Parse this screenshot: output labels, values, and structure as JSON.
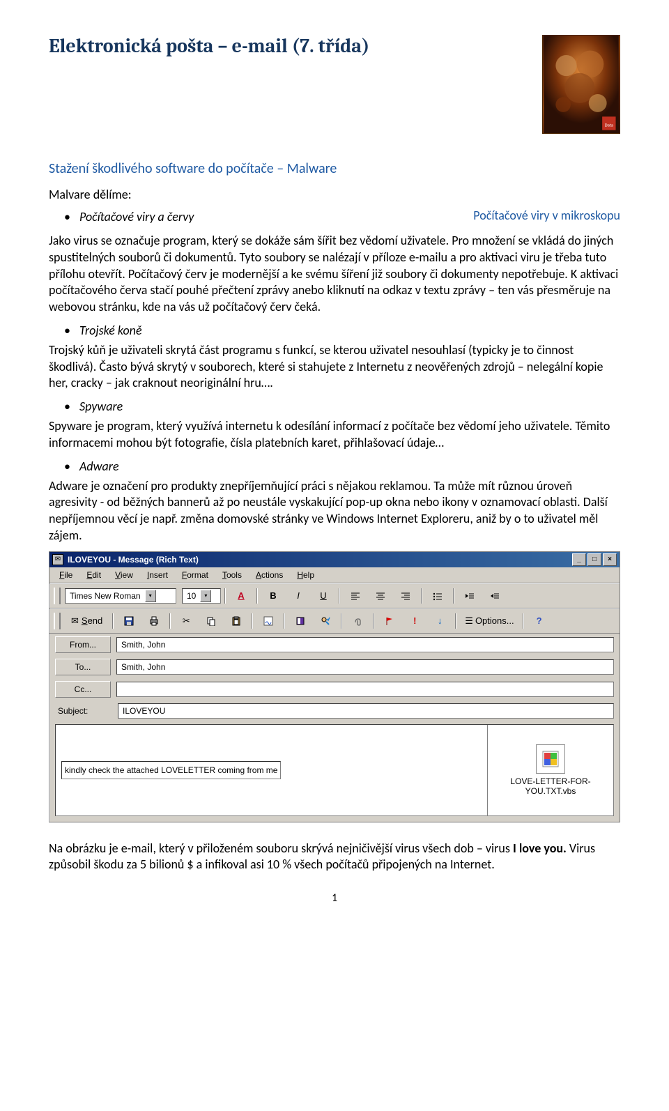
{
  "doc": {
    "title": "Elektronická pošta – e-mail (7. třída)",
    "subheading": "Stažení škodlivého software do počítače – Malware",
    "intro_label": "Malvare dělíme:",
    "caption_right": "Počítačové viry v mikroskopu",
    "page_number": "1",
    "sections": {
      "viry": {
        "bullet": "Počítačové viry a červy",
        "para": "Jako virus se označuje program, který se dokáže sám šířit bez vědomí uživatele. Pro množení se vkládá do jiných spustitelných souborů či dokumentů. Tyto soubory se nalézají v příloze e-mailu a pro aktivaci viru je třeba tuto přílohu otevřít. Počítačový červ je modernější a ke svému šíření již soubory či dokumenty nepotřebuje. K aktivaci počítačového červa stačí pouhé přečtení zprávy anebo kliknutí na odkaz v textu zprávy – ten vás přesměruje na webovou stránku, kde na vás už počítačový červ čeká."
      },
      "trojske": {
        "bullet": "Trojské koně",
        "para": "Trojský kůň je uživateli skrytá část programu s funkcí, se kterou uživatel nesouhlasí (typicky je to činnost škodlivá). Často bývá skrytý v souborech, které si stahujete z Internetu z neověřených zdrojů – nelegální kopie her, cracky – jak craknout neoriginální hru…."
      },
      "spyware": {
        "bullet": "Spyware",
        "para": "Spyware je program, který využívá internetu k odesílání informací z počítače bez vědomí jeho uživatele. Těmito informacemi mohou být fotografie, čísla platebních karet, přihlašovací údaje…"
      },
      "adware": {
        "bullet": "Adware",
        "para": "Adware je označení pro produkty znepříjemňující práci s nějakou reklamou. Ta může mít různou úroveň agresivity - od běžných bannerů  až po neustále vyskakující pop-up okna nebo ikony v oznamovací oblasti. Další nepříjemnou věcí je např. změna domovské stránky ve Windows Internet Exploreru, aniž by o to uživatel měl zájem."
      }
    },
    "closing_pre": "Na obrázku je e-mail, který v přiloženém souboru skrývá nejničivější virus všech dob – virus ",
    "closing_bold": "I love you.",
    "closing_post": " Virus způsobil škodu za 5 bilionů $ a infikoval asi 10 % všech počítačů připojených na Internet."
  },
  "email": {
    "title": "ILOVEYOU - Message (Rich Text)",
    "menus": [
      "File",
      "Edit",
      "View",
      "Insert",
      "Format",
      "Tools",
      "Actions",
      "Help"
    ],
    "font_name": "Times New Roman",
    "font_size": "10",
    "send_label": "Send",
    "options_label": "Options...",
    "fields": {
      "from_label": "From...",
      "from_value": "Smith, John",
      "to_label": "To...",
      "to_value": "Smith, John",
      "cc_label": "Cc...",
      "cc_value": "",
      "subject_label": "Subject:",
      "subject_value": "ILOVEYOU"
    },
    "body_text": "kindly check the attached LOVELETTER coming from me",
    "attachment_name": "LOVE-LETTER-FOR-YOU.TXT.vbs"
  },
  "icons": {
    "minimize": "_",
    "maximize": "□",
    "close": "×",
    "arrow": "▾",
    "bold": "B",
    "italic": "I",
    "underline": "U",
    "font_color": "A",
    "help": "?"
  }
}
